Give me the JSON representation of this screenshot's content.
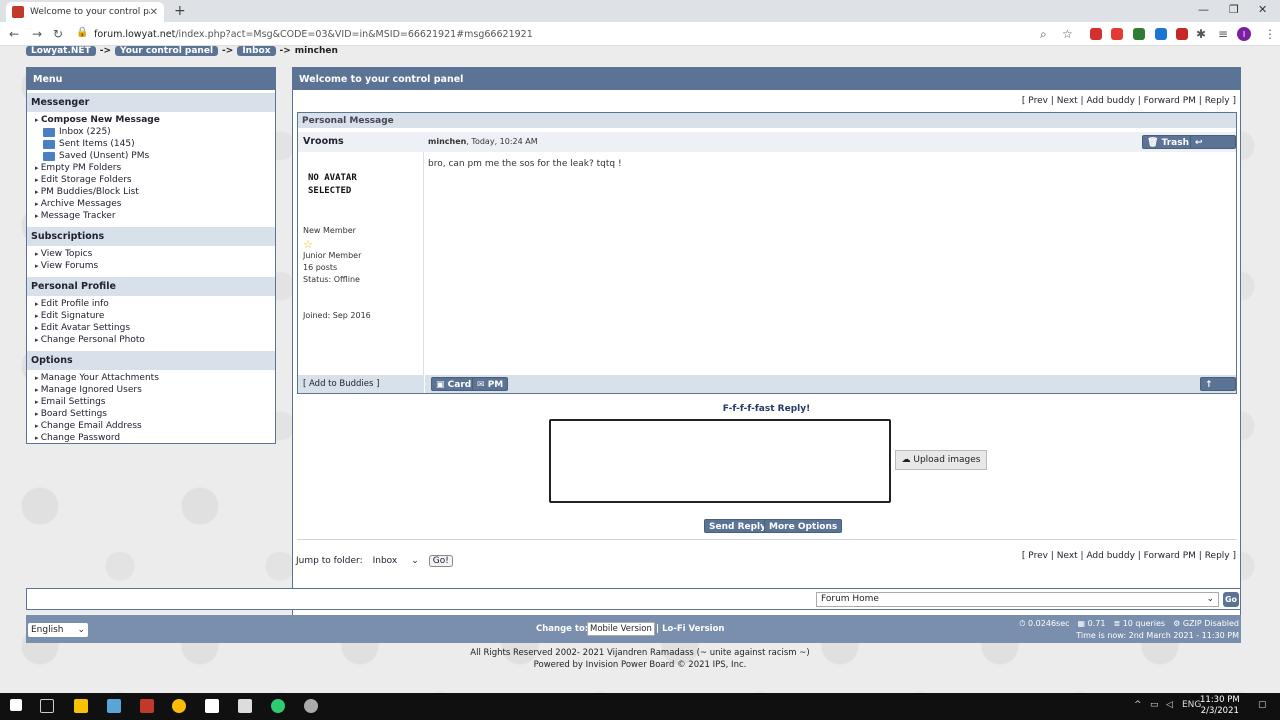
{
  "browser": {
    "tab_title": "Welcome to your control panel",
    "url_host": "forum.lowyat.net",
    "url_path": "/index.php?act=Msg&CODE=03&VID=in&MSID=66621921#msg66621921",
    "profile_initial": "I"
  },
  "breadcrumb": [
    "Lowyat.NET",
    "Your control panel",
    "Inbox",
    "minchen"
  ],
  "breadcrumb_sep": "->",
  "menu": {
    "title": "Menu",
    "sections": [
      {
        "title": "Messenger"
      },
      {
        "title": "Subscriptions"
      },
      {
        "title": "Personal Profile"
      },
      {
        "title": "Options"
      }
    ],
    "messenger": {
      "compose": "Compose New Message",
      "inbox": "Inbox (225)",
      "sent": "Sent Items (145)",
      "saved": "Saved (Unsent) PMs",
      "items": [
        "Empty PM Folders",
        "Edit Storage Folders",
        "PM Buddies/Block List",
        "Archive Messages",
        "Message Tracker"
      ]
    },
    "subscriptions": [
      "View Topics",
      "View Forums"
    ],
    "profile": [
      "Edit Profile info",
      "Edit Signature",
      "Edit Avatar Settings",
      "Change Personal Photo"
    ],
    "options": [
      "Manage Your Attachments",
      "Manage Ignored Users",
      "Email Settings",
      "Board Settings",
      "Change Email Address",
      "Change Password"
    ]
  },
  "main": {
    "title": "Welcome to your control panel",
    "links": [
      "Prev",
      "Next",
      "Add buddy",
      "Forward PM",
      "Reply"
    ],
    "pm_header": "Personal Message",
    "sender": "Vrooms",
    "from_user": "minchen",
    "timestamp": ", Today, 10:24 AM",
    "trash_label": "Trash",
    "reply_label": "Reply",
    "no_avatar_1": "NO AVATAR",
    "no_avatar_2": "SELECTED",
    "rank": "New Member",
    "group": "Junior Member",
    "posts": "16 posts",
    "status": "Status: Offline",
    "joined": "Joined: Sep 2016",
    "message": "bro, can pm me the sos for the leak? tqtq !",
    "add_buddies": "[ Add to Buddies ]",
    "card_label": "Card",
    "pm_label": "PM",
    "top_label": "Top",
    "fast_reply": "F-f-f-f-fast Reply!",
    "upload_label": "Upload images",
    "send_reply": "Send Reply",
    "more_options": "More Options",
    "jump_label": "Jump to folder:",
    "folder_value": "Inbox",
    "go_label": "Go!"
  },
  "footer": {
    "forum_select": "Forum Home",
    "go": "Go",
    "language": "English",
    "change_to": "Change to:",
    "mobile": "Mobile Version",
    "lofi": "| Lo-Fi Version",
    "exec_time": "0.0246sec",
    "load": "0.71",
    "queries": "10 queries",
    "gzip": "GZIP Disabled",
    "time_now": "Time is now: 2nd March 2021 - 11:30 PM",
    "copyright1": "All Rights Reserved 2002- 2021 Vijandren Ramadass (~ unite against racism ~)",
    "copyright2": "Powered by Invision Power Board © 2021  IPS, Inc."
  },
  "taskbar": {
    "lang": "ENG",
    "time": "11:30 PM",
    "date": "2/3/2021"
  }
}
